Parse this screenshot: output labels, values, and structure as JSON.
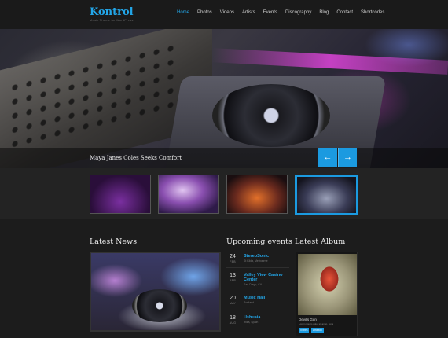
{
  "site": {
    "title": "Kontrol",
    "tagline": "Music Theme for WordPress"
  },
  "nav": {
    "items": [
      "Home",
      "Photos",
      "Videos",
      "Artists",
      "Events",
      "Discography",
      "Blog",
      "Contact",
      "Shortcodes"
    ],
    "active_index": 0
  },
  "hero": {
    "caption": "Maya Janes Coles Seeks Comfort",
    "prev_icon": "←",
    "next_icon": "→"
  },
  "thumbnails": {
    "count": 4,
    "active_index": 3
  },
  "sections": {
    "news_title": "Latest News",
    "events_title": "Upcoming events",
    "album_title": "Latest Album"
  },
  "events": [
    {
      "day": "24",
      "month": "FEB",
      "title": "StereoSonic",
      "location": "St Kilda, Melbourne"
    },
    {
      "day": "13",
      "month": "APR",
      "title": "Valley View Casino Center",
      "location": "San Diego, CA"
    },
    {
      "day": "20",
      "month": "MAY",
      "title": "Music Hall",
      "location": "Portland"
    },
    {
      "day": "18",
      "month": "AUG",
      "title": "Ushuaia",
      "location": "Ibiza, Spain"
    }
  ],
  "album": {
    "title": "Devil's Gun",
    "subtitle": "Lorem ipsum dolor sit amet, cons",
    "buttons": [
      "iTunes",
      "Amazon"
    ]
  },
  "colors": {
    "accent": "#1b9ae0",
    "background": "#1c1c1c"
  }
}
